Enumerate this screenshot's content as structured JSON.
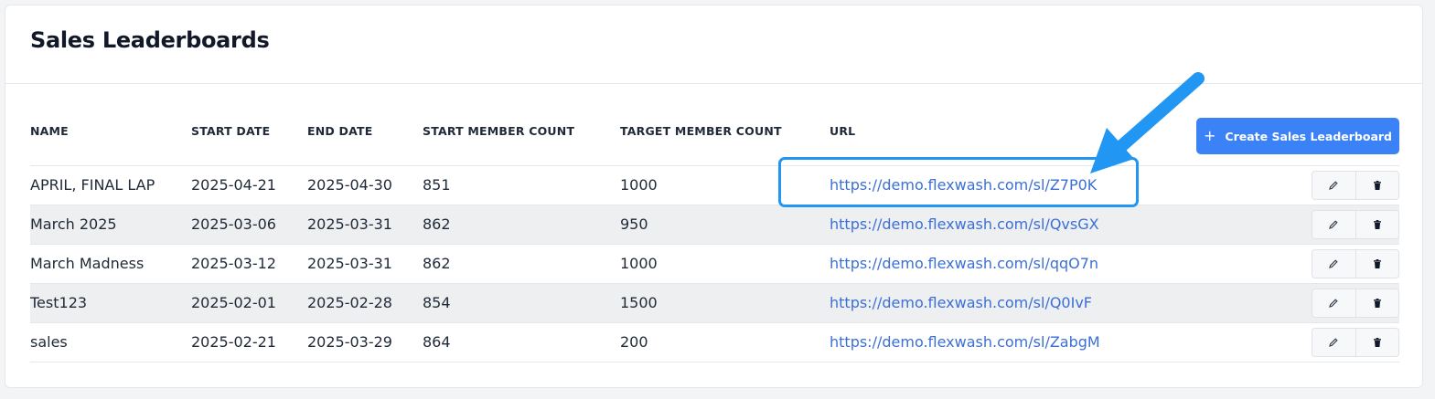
{
  "page": {
    "title": "Sales Leaderboards",
    "create_button_label": "Create Sales Leaderboard",
    "create_button_icon": "plus-icon"
  },
  "table": {
    "columns": [
      "NAME",
      "START DATE",
      "END DATE",
      "START MEMBER COUNT",
      "TARGET MEMBER COUNT",
      "URL"
    ],
    "rows": [
      {
        "name": "APRIL, FINAL LAP",
        "start_date": "2025-04-21",
        "end_date": "2025-04-30",
        "start_member_count": "851",
        "target_member_count": "1000",
        "url": "https://demo.flexwash.com/sl/Z7P0K"
      },
      {
        "name": "March 2025",
        "start_date": "2025-03-06",
        "end_date": "2025-03-31",
        "start_member_count": "862",
        "target_member_count": "950",
        "url": "https://demo.flexwash.com/sl/QvsGX"
      },
      {
        "name": "March Madness",
        "start_date": "2025-03-12",
        "end_date": "2025-03-31",
        "start_member_count": "862",
        "target_member_count": "1000",
        "url": "https://demo.flexwash.com/sl/qqO7n"
      },
      {
        "name": "Test123",
        "start_date": "2025-02-01",
        "end_date": "2025-02-28",
        "start_member_count": "854",
        "target_member_count": "1500",
        "url": "https://demo.flexwash.com/sl/Q0IvF"
      },
      {
        "name": "sales",
        "start_date": "2025-02-21",
        "end_date": "2025-03-29",
        "start_member_count": "864",
        "target_member_count": "200",
        "url": "https://demo.flexwash.com/sl/ZabgM"
      }
    ],
    "row_actions": [
      "pencil-icon",
      "trash-icon"
    ]
  },
  "colors": {
    "primary": "#3b82f6",
    "link": "#3b6fd6",
    "annotation": "#2196f3",
    "stripe": "#eeeff1"
  }
}
